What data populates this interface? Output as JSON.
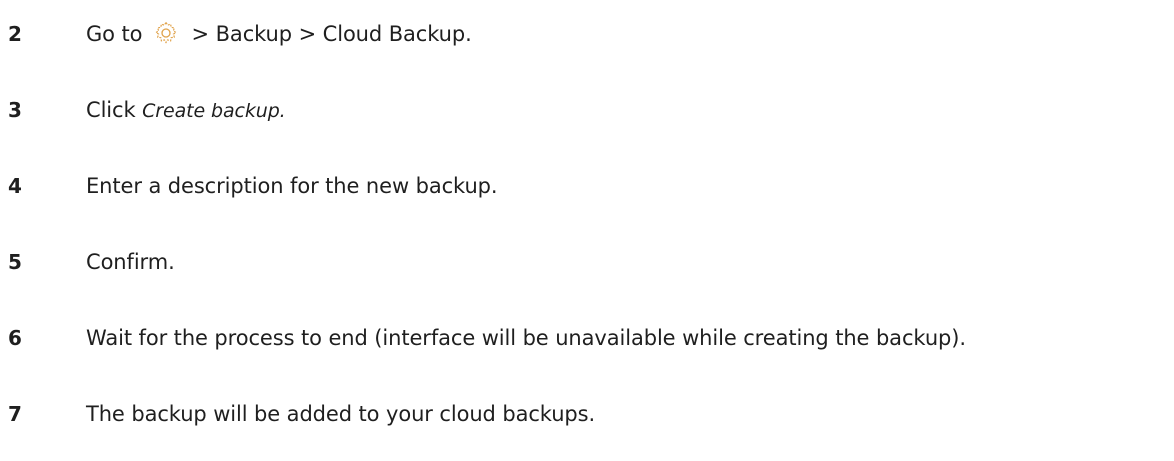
{
  "steps": [
    {
      "number": "2",
      "before_icon": "Go to",
      "icon": "gear-icon",
      "after_icon": "> Backup > Cloud Backup."
    },
    {
      "number": "3",
      "text": "Click",
      "emphasis": "Create backup."
    },
    {
      "number": "4",
      "text": "Enter a description for the new backup."
    },
    {
      "number": "5",
      "text": "Confirm."
    },
    {
      "number": "6",
      "text": "Wait for the process to end (interface will be unavailable while creating the backup)."
    },
    {
      "number": "7",
      "text": "The backup will be added to your cloud backups."
    }
  ],
  "colors": {
    "text": "#1f1f1f",
    "icon_accent": "#e0a24a"
  }
}
